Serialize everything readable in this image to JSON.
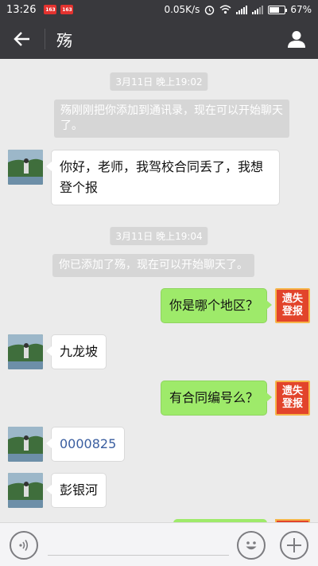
{
  "status_bar": {
    "time": "13:26",
    "network_speed": "0.05K/s",
    "battery_percent": "67%",
    "battery_level": 0.67
  },
  "header": {
    "title": "殇"
  },
  "messages": {
    "timestamp_1": "3月11日 晚上19:02",
    "system_1": "殇刚刚把你添加到通讯录，现在可以开始聊天了。",
    "msg_1": "你好，老师，我驾校合同丢了，我想登个报",
    "timestamp_2": "3月11日 晚上19:04",
    "system_2": "你已添加了殇，现在可以开始聊天了。",
    "msg_2": "你是哪个地区？",
    "msg_3": "九龙坡",
    "msg_4": "有合同编号么？",
    "msg_5": "0000825",
    "msg_6": "彭银河",
    "stamp_line1": "遗失",
    "stamp_line2": "登报"
  },
  "colors": {
    "header_bg": "#39393d",
    "chat_bg": "#ebebeb",
    "sent_bubble": "#9eea6a",
    "stamp_red": "#e2442b"
  }
}
